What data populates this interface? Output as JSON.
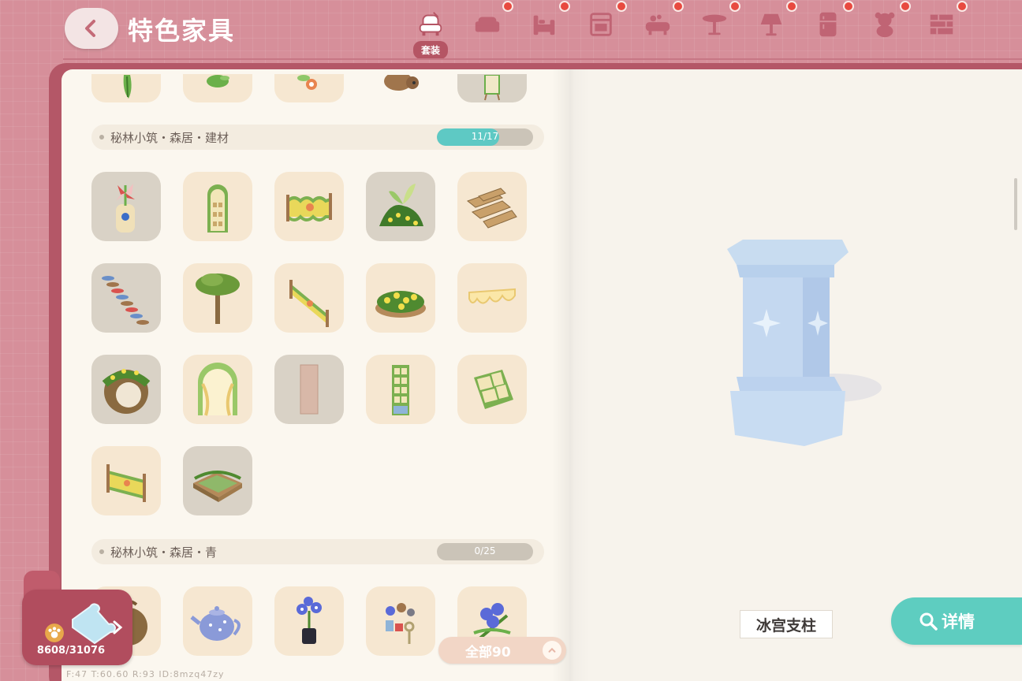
{
  "header": {
    "title": "特色家具",
    "tabs": [
      {
        "name": "suit",
        "label": "套装",
        "active": true,
        "badge": false
      },
      {
        "name": "sofa",
        "label": "",
        "badge": true
      },
      {
        "name": "bed",
        "label": "",
        "badge": true
      },
      {
        "name": "cabinet",
        "label": "",
        "badge": true
      },
      {
        "name": "bathtub",
        "label": "",
        "badge": true
      },
      {
        "name": "table",
        "label": "",
        "badge": true
      },
      {
        "name": "lamp",
        "label": "",
        "badge": true
      },
      {
        "name": "fridge",
        "label": "",
        "badge": true
      },
      {
        "name": "teddy",
        "label": "",
        "badge": true
      },
      {
        "name": "wall",
        "label": "",
        "badge": true
      }
    ]
  },
  "sections": [
    {
      "name": "秘林小筑・森居・建材",
      "progress_text": "11/17",
      "progress": 0.647
    },
    {
      "name": "秘林小筑・森居・青",
      "progress_text": "0/25",
      "progress": 0
    }
  ],
  "filter": {
    "label": "全部90"
  },
  "collection": {
    "count": "8608/31076"
  },
  "selected_item": {
    "name": "冰宫支柱"
  },
  "detail_button": {
    "label": "详情"
  },
  "debug_text": "F:47  T:60.60  R:93  ID:8mzq47zy",
  "colors": {
    "accent": "#5ecdc0",
    "book": "#b45767",
    "background": "#d68f9a",
    "badge": "#e84a40"
  }
}
